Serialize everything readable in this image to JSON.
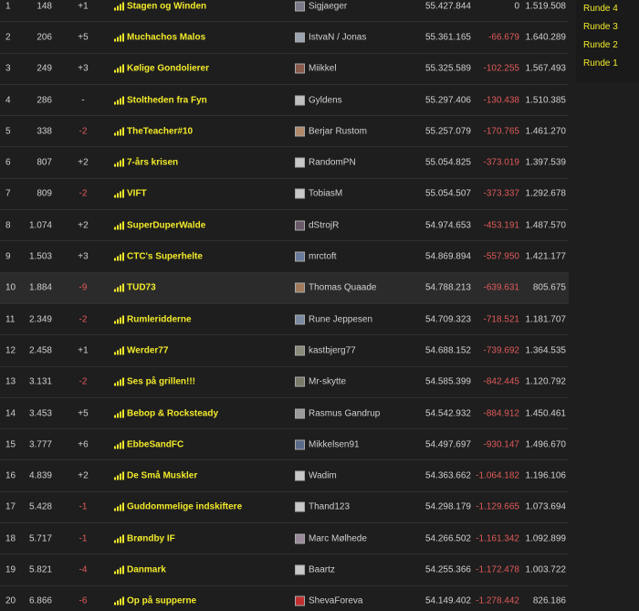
{
  "side_menu": {
    "items": [
      "Runde 4",
      "Runde 3",
      "Runde 2",
      "Runde 1"
    ]
  },
  "rows": [
    {
      "pos": "1",
      "rank": "148",
      "change": "+1",
      "team": "Stagen og Winden",
      "user": "Sigjaeger",
      "total": "55.427.844",
      "diff": "0",
      "round": "1.519.508",
      "avatar_color": "#7a7a8a"
    },
    {
      "pos": "2",
      "rank": "206",
      "change": "+5",
      "team": "Muchachos Malos",
      "user": "IstvaN / Jonas",
      "total": "55.361.165",
      "diff": "-66.679",
      "round": "1.640.289",
      "avatar_color": "#9aa4b0"
    },
    {
      "pos": "3",
      "rank": "249",
      "change": "+3",
      "team": "Kølige Gondolierer",
      "user": "Miikkel",
      "total": "55.325.589",
      "diff": "-102.255",
      "round": "1.567.493",
      "avatar_color": "#8a5a4a"
    },
    {
      "pos": "4",
      "rank": "286",
      "change": "-",
      "team": "Stoltheden fra Fyn",
      "user": "Gyldens",
      "total": "55.297.406",
      "diff": "-130.438",
      "round": "1.510.385",
      "avatar_color": "#c0c0c0"
    },
    {
      "pos": "5",
      "rank": "338",
      "change": "-2",
      "team": "TheTeacher#10",
      "user": "Berjar Rustom",
      "total": "55.257.079",
      "diff": "-170.765",
      "round": "1.461.270",
      "avatar_color": "#b08a6a"
    },
    {
      "pos": "6",
      "rank": "807",
      "change": "+2",
      "team": "7-års krisen",
      "user": "RandomPN",
      "total": "55.054.825",
      "diff": "-373.019",
      "round": "1.397.539",
      "avatar_color": "#c8c8c8"
    },
    {
      "pos": "7",
      "rank": "809",
      "change": "-2",
      "team": "VIFT",
      "user": "TobiasM",
      "total": "55.054.507",
      "diff": "-373.337",
      "round": "1.292.678",
      "avatar_color": "#c8c8c8"
    },
    {
      "pos": "8",
      "rank": "1.074",
      "change": "+2",
      "team": "SuperDuperWalde",
      "user": "dStrojR",
      "total": "54.974.653",
      "diff": "-453.191",
      "round": "1.487.570",
      "avatar_color": "#6a5a6a"
    },
    {
      "pos": "9",
      "rank": "1.503",
      "change": "+3",
      "team": "CTC's Superhelte",
      "user": "mrctoft",
      "total": "54.869.894",
      "diff": "-557.950",
      "round": "1.421.177",
      "avatar_color": "#6a7a9a"
    },
    {
      "pos": "10",
      "rank": "1.884",
      "change": "-9",
      "team": "TUD73",
      "user": "Thomas Quaade",
      "total": "54.788.213",
      "diff": "-639.631",
      "round": "805.675",
      "avatar_color": "#a07a5a",
      "highlight": true
    },
    {
      "pos": "11",
      "rank": "2.349",
      "change": "-2",
      "team": "Rumleridderne",
      "user": "Rune Jeppesen",
      "total": "54.709.323",
      "diff": "-718.521",
      "round": "1.181.707",
      "avatar_color": "#7a8aa0"
    },
    {
      "pos": "12",
      "rank": "2.458",
      "change": "+1",
      "team": "Werder77",
      "user": "kastbjerg77",
      "total": "54.688.152",
      "diff": "-739.692",
      "round": "1.364.535",
      "avatar_color": "#8a8a7a"
    },
    {
      "pos": "13",
      "rank": "3.131",
      "change": "-2",
      "team": "Ses på grillen!!!",
      "user": "Mr-skytte",
      "total": "54.585.399",
      "diff": "-842.445",
      "round": "1.120.792",
      "avatar_color": "#7a7a6a"
    },
    {
      "pos": "14",
      "rank": "3.453",
      "change": "+5",
      "team": "Bebop & Rocksteady",
      "user": "Rasmus Gandrup",
      "total": "54.542.932",
      "diff": "-884.912",
      "round": "1.450.461",
      "avatar_color": "#9a9a9a"
    },
    {
      "pos": "15",
      "rank": "3.777",
      "change": "+6",
      "team": "EbbeSandFC",
      "user": "Mikkelsen91",
      "total": "54.497.697",
      "diff": "-930.147",
      "round": "1.496.670",
      "avatar_color": "#5a6a8a"
    },
    {
      "pos": "16",
      "rank": "4.839",
      "change": "+2",
      "team": "De Små Muskler",
      "user": "Wadim",
      "total": "54.363.662",
      "diff": "-1.064.182",
      "round": "1.196.106",
      "avatar_color": "#c8c8c8"
    },
    {
      "pos": "17",
      "rank": "5.428",
      "change": "-1",
      "team": "Guddommelige indskiftere",
      "user": "Thand123",
      "total": "54.298.179",
      "diff": "-1.129.665",
      "round": "1.073.694",
      "avatar_color": "#c8c8c8"
    },
    {
      "pos": "18",
      "rank": "5.717",
      "change": "-1",
      "team": "Brøndby IF",
      "user": "Marc Mølhede",
      "total": "54.266.502",
      "diff": "-1.161.342",
      "round": "1.092.899",
      "avatar_color": "#9a8a9a"
    },
    {
      "pos": "19",
      "rank": "5.821",
      "change": "-4",
      "team": "Danmark",
      "user": "Baartz",
      "total": "54.255.366",
      "diff": "-1.172.478",
      "round": "1.003.722",
      "avatar_color": "#c8c8c8"
    },
    {
      "pos": "20",
      "rank": "6.866",
      "change": "-6",
      "team": "Op på supperne",
      "user": "ShevaForeva",
      "total": "54.149.402",
      "diff": "-1.278.442",
      "round": "826.186",
      "avatar_color": "#c03030"
    }
  ],
  "colors": {
    "accent": "#f2ea2a",
    "negative": "#e05a5a",
    "background": "#1e1e1e",
    "text": "#d0d0d0"
  },
  "icons": {
    "team": "bar-chart-icon",
    "user": "avatar"
  }
}
